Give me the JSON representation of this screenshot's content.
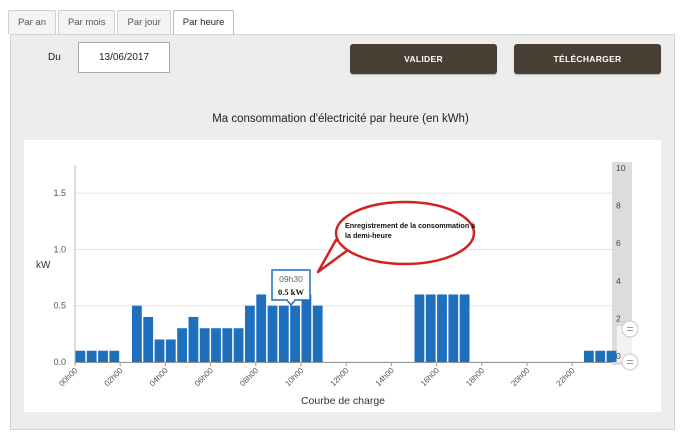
{
  "tabs": [
    {
      "label": "Par an",
      "active": false
    },
    {
      "label": "Par mois",
      "active": false
    },
    {
      "label": "Par jour",
      "active": false
    },
    {
      "label": "Par heure",
      "active": true
    }
  ],
  "form": {
    "date_label": "Du",
    "date_value": "13/06/2017",
    "validate_label": "VALIDER",
    "download_label": "TÉLÉCHARGER"
  },
  "chart_data": {
    "type": "bar",
    "title": "Ma consommation d'électricité par heure (en kWh)",
    "xlabel": "Courbe de charge",
    "ylabel": "kW",
    "ylim": [
      0,
      1.75
    ],
    "yticks": [
      "0.0",
      "0.5",
      "1.0",
      "1.5"
    ],
    "xticks": [
      "00h00",
      "02h00",
      "04h00",
      "06h00",
      "08h00",
      "10h00",
      "12h00",
      "14h00",
      "16h00",
      "18h00",
      "20h00",
      "22h00"
    ],
    "navigator_ticks": [
      "10",
      "8",
      "6",
      "4",
      "2",
      "0"
    ],
    "bar_color": "#1f6fbf",
    "values": [
      0.1,
      0.1,
      0.1,
      0.1,
      0,
      0.5,
      0.4,
      0.2,
      0.2,
      0.3,
      0.4,
      0.3,
      0.3,
      0.3,
      0.3,
      0.5,
      0.6,
      0.5,
      0.5,
      0.5,
      0.6,
      0.5,
      0,
      0,
      0,
      0,
      0,
      0,
      0,
      0,
      0.6,
      0.6,
      0.6,
      0.6,
      0.6,
      0,
      0,
      0,
      0,
      0,
      0,
      0,
      0,
      0,
      0,
      0.1,
      0.1,
      0.1
    ],
    "tooltip": {
      "time": "09h30",
      "value": "0.5 kW"
    },
    "annotation": "Enregistrement de la consommation à la demi-heure"
  }
}
